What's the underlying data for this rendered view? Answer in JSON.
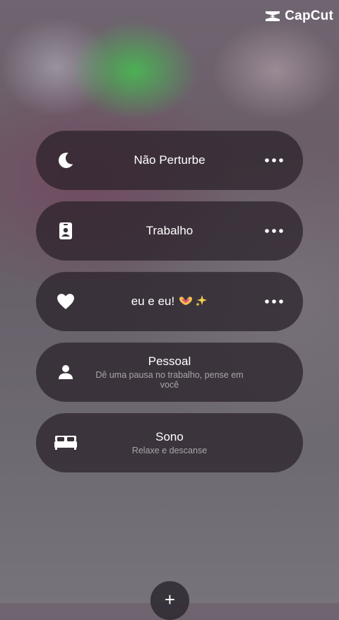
{
  "watermark": {
    "text": "CapCut",
    "icon": "capcut-logo-icon"
  },
  "focus_modes": [
    {
      "icon": "moon-icon",
      "title": "Não Perturbe",
      "subtitle": "",
      "has_more": true
    },
    {
      "icon": "id-badge-icon",
      "title": "Trabalho",
      "subtitle": "",
      "has_more": true
    },
    {
      "icon": "heart-icon",
      "title": "eu e eu!",
      "title_emoji": [
        "heart-hands-emoji",
        "sparkles-emoji"
      ],
      "subtitle": "",
      "has_more": true
    },
    {
      "icon": "person-icon",
      "title": "Pessoal",
      "subtitle": "Dê uma pausa no trabalho, pense em você",
      "has_more": false
    },
    {
      "icon": "bed-icon",
      "title": "Sono",
      "subtitle": "Relaxe e descanse",
      "has_more": false
    }
  ],
  "add_button": {
    "label": "+",
    "icon": "plus-icon"
  }
}
